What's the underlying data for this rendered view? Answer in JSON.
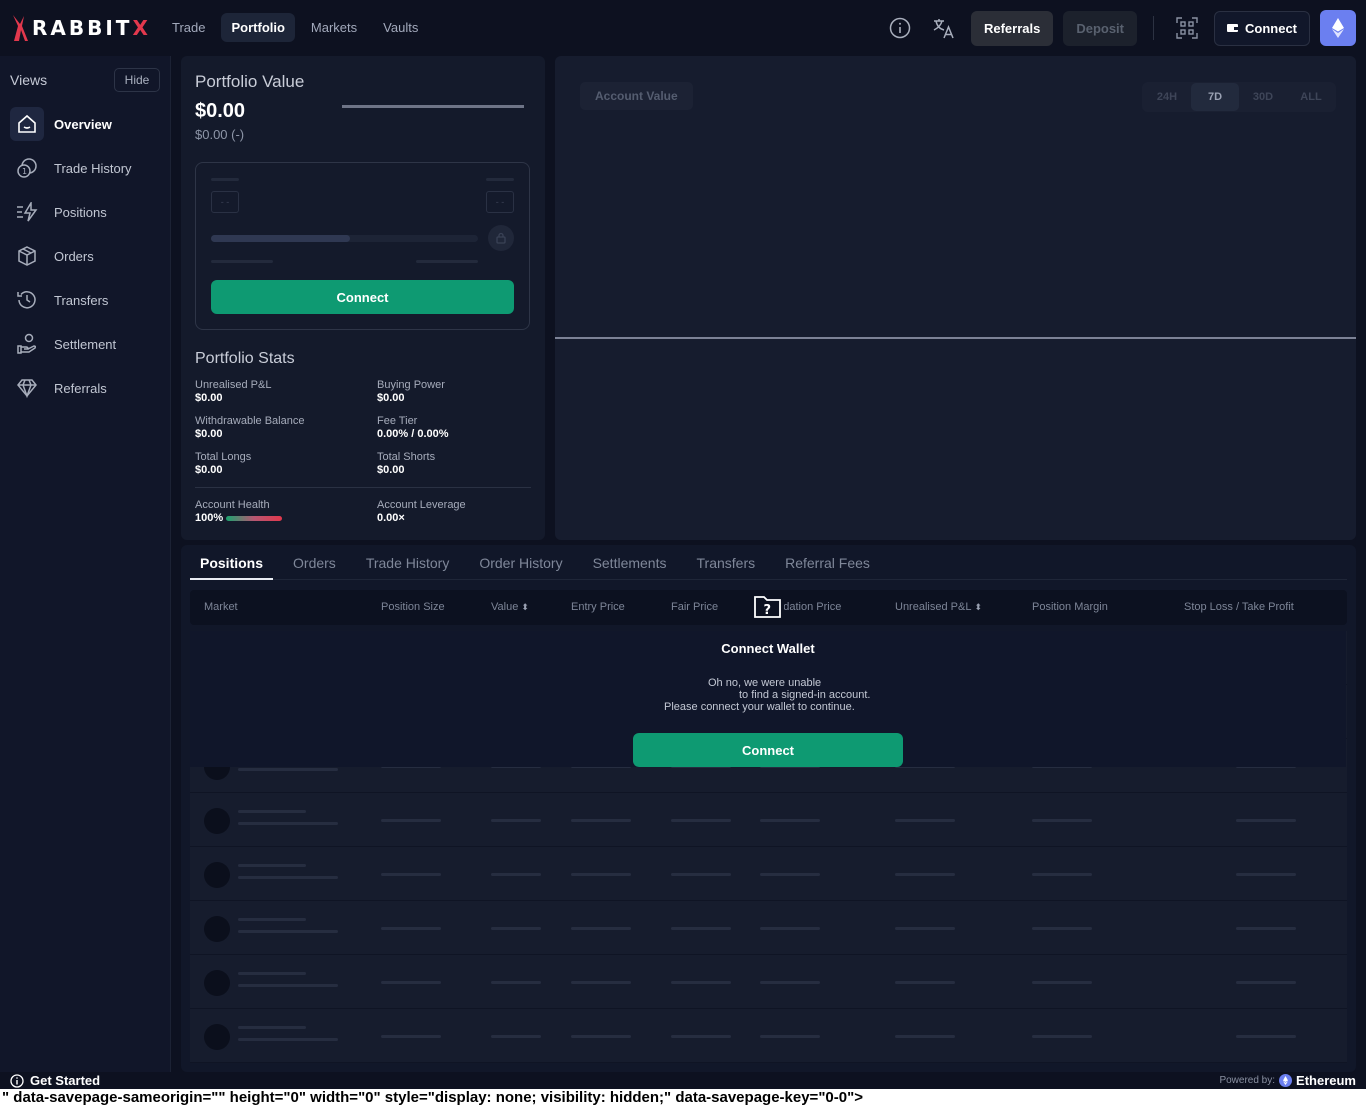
{
  "app": {
    "logo_text_main": "RABBIT",
    "logo_text_x": "X"
  },
  "nav": {
    "items": [
      "Trade",
      "Portfolio",
      "Markets",
      "Vaults"
    ],
    "active": "Portfolio"
  },
  "topbar": {
    "referrals_label": "Referrals",
    "deposit_label": "Deposit",
    "connect_label": "Connect",
    "info_icon": "info-icon",
    "translate_icon": "translate-icon",
    "qr_icon": "qr-scan-icon",
    "wallet_icon": "wallet-icon",
    "network_icon": "ethereum-icon"
  },
  "sidebar": {
    "views_label": "Views",
    "hide_label": "Hide",
    "items": [
      {
        "label": "Overview",
        "icon": "home-icon",
        "active": true
      },
      {
        "label": "Trade History",
        "icon": "history-coin-icon"
      },
      {
        "label": "Positions",
        "icon": "lightning-lines-icon"
      },
      {
        "label": "Orders",
        "icon": "box-icon"
      },
      {
        "label": "Transfers",
        "icon": "clock-history-icon"
      },
      {
        "label": "Settlement",
        "icon": "hand-coin-icon"
      },
      {
        "label": "Referrals",
        "icon": "diamond-icon"
      }
    ]
  },
  "portfolio": {
    "title": "Portfolio Value",
    "value": "$0.00",
    "change": "$0.00 (-)",
    "skeleton_left": "- -",
    "skeleton_right": "- -",
    "connect_label": "Connect",
    "stats_title": "Portfolio Stats",
    "stats": {
      "unrealised_pnl": {
        "label": "Unrealised P&L",
        "value": "$0.00"
      },
      "buying_power": {
        "label": "Buying Power",
        "value": "$0.00"
      },
      "withdrawable": {
        "label": "Withdrawable Balance",
        "value": "$0.00"
      },
      "fee_tier": {
        "label": "Fee Tier",
        "value": "0.00% / 0.00%"
      },
      "total_longs": {
        "label": "Total Longs",
        "value": "$0.00"
      },
      "total_shorts": {
        "label": "Total Shorts",
        "value": "$0.00"
      },
      "account_health": {
        "label": "Account Health",
        "value": "100%"
      },
      "account_leverage": {
        "label": "Account Leverage",
        "value": "0.00×"
      }
    }
  },
  "chart": {
    "metric_label": "Account Value",
    "ranges": [
      "24H",
      "7D",
      "30D",
      "ALL"
    ],
    "active_range": "7D"
  },
  "positions_panel": {
    "tabs": [
      "Positions",
      "Orders",
      "Trade History",
      "Order History",
      "Settlements",
      "Transfers",
      "Referral Fees"
    ],
    "active_tab": "Positions",
    "columns": [
      "Market",
      "Position Size",
      "Value",
      "Entry Price",
      "Fair Price",
      "Liquidation Price",
      "Unrealised P&L",
      "Position Margin",
      "Stop Loss / Take Profit"
    ],
    "sort_glyph": "⬍",
    "empty_state": {
      "icon": "folder-question-icon",
      "title": "Connect Wallet",
      "line1": "Oh no, we were unable",
      "line2": "to find a signed-in account.",
      "line3": "Please connect your wallet to continue.",
      "button": "Connect"
    }
  },
  "footer": {
    "get_started": "Get Started",
    "powered_by": "Powered by:",
    "network": "Ethereum",
    "artifact_text": "\" data-savepage-sameorigin=\"\" height=\"0\" width=\"0\" style=\"display: none; visibility: hidden;\" data-savepage-key=\"0-0\">"
  },
  "colors": {
    "background": "#0d1120",
    "panel": "#141a2b",
    "accent_green": "#0e9a72",
    "brand_red": "#e2384d",
    "eth_blue": "#6b7ff0"
  }
}
